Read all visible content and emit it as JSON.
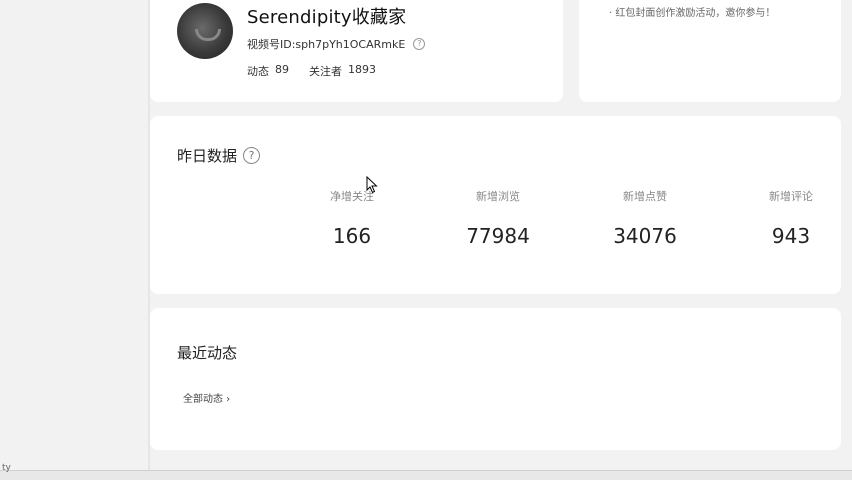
{
  "profile": {
    "name": "Serendipity收藏家",
    "id_label": "视频号ID:",
    "id_value": "sph7pYh1OCARmkE",
    "posts_label": "动态",
    "posts_count": "89",
    "followers_label": "关注者",
    "followers_count": "1893"
  },
  "notice": {
    "text": "· 红包封面创作激励活动，邀你参与！"
  },
  "yesterday": {
    "title": "昨日数据",
    "metrics": [
      {
        "label": "净增关注",
        "value": "166"
      },
      {
        "label": "新增浏览",
        "value": "77984"
      },
      {
        "label": "新增点赞",
        "value": "34076"
      },
      {
        "label": "新增评论",
        "value": "943"
      }
    ]
  },
  "recent": {
    "title": "最近动态",
    "all_link": "全部动态 ›"
  },
  "footer": {
    "fragment": "ty"
  },
  "icons": {
    "help": "help-icon",
    "cursor": "cursor-arrow-icon"
  }
}
